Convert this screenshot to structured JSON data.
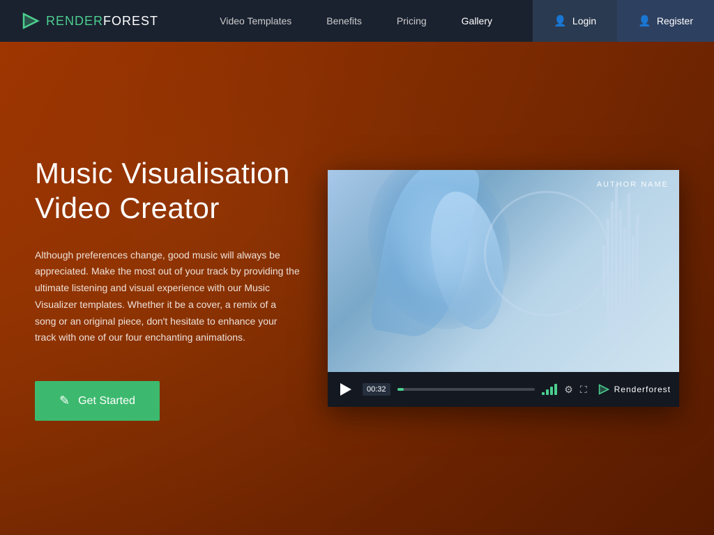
{
  "nav": {
    "logo_render": "RENDER",
    "logo_forest": "FOREST",
    "links": [
      {
        "label": "Video Templates",
        "active": false
      },
      {
        "label": "Benefits",
        "active": false
      },
      {
        "label": "Pricing",
        "active": false
      },
      {
        "label": "Gallery",
        "active": true
      }
    ],
    "login_label": "Login",
    "register_label": "Register"
  },
  "hero": {
    "title": "Music Visualisation Video Creator",
    "description": "Although preferences change, good music will always be appreciated. Make the most out of your track by providing the ultimate listening and visual experience with our Music Visualizer templates. Whether it be a cover, a remix of a song or an original piece, don't hesitate to enhance your track with one of our four enchanting animations.",
    "cta_label": "Get Started"
  },
  "video": {
    "author_label": "AUTHOR NAME",
    "time": "00:32",
    "brand": "Renderforest",
    "progress_percent": 5
  },
  "colors": {
    "accent_green": "#3cb96e",
    "nav_bg": "#1a2230",
    "hero_overlay": "rgba(180,60,0,0.85)"
  }
}
